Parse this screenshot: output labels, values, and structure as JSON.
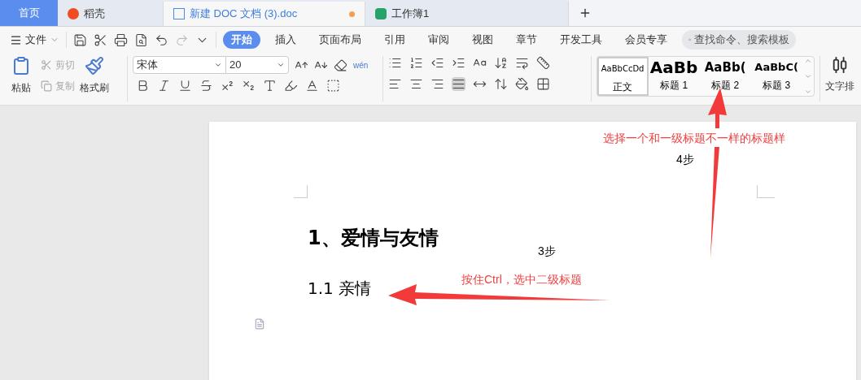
{
  "tabs": [
    {
      "label": "首页",
      "kind": "home",
      "selected": false
    },
    {
      "label": "稻壳",
      "kind": "docer",
      "selected": false
    },
    {
      "label": "新建 DOC 文档 (3).doc",
      "kind": "writer",
      "selected": true,
      "unsaved": true
    },
    {
      "label": "工作簿1",
      "kind": "sheet",
      "selected": false
    }
  ],
  "menu": {
    "file": "文件",
    "items": [
      {
        "label": "开始",
        "selected": true
      },
      {
        "label": "插入",
        "selected": false
      },
      {
        "label": "页面布局",
        "selected": false
      },
      {
        "label": "引用",
        "selected": false
      },
      {
        "label": "审阅",
        "selected": false
      },
      {
        "label": "视图",
        "selected": false
      },
      {
        "label": "章节",
        "selected": false
      },
      {
        "label": "开发工具",
        "selected": false
      },
      {
        "label": "会员专享",
        "selected": false
      }
    ],
    "search_placeholder": "查找命令、搜索模板"
  },
  "clipboard": {
    "paste": "粘贴",
    "cut": "剪切",
    "copy": "复制",
    "format_painter": "格式刷"
  },
  "font": {
    "name": "宋体",
    "size": "20",
    "phonetic": "wén"
  },
  "styles": [
    {
      "preview": "AaBbCcDd",
      "label": "正文",
      "kind": "normal",
      "selected": true
    },
    {
      "preview": "AaBb",
      "label": "标题 1",
      "kind": "h1",
      "selected": false
    },
    {
      "preview": "AaBb(",
      "label": "标题 2",
      "kind": "h2",
      "selected": false
    },
    {
      "preview": "AaBbC(",
      "label": "标题 3",
      "kind": "h3",
      "selected": false
    }
  ],
  "text_tool": "文字排",
  "document": {
    "heading_1": "1、爱情与友情",
    "heading_2": "1.1 亲情"
  },
  "annotations": [
    {
      "text": "选择一个和一级标题不一样的标题样",
      "kind": "note"
    },
    {
      "text": "4步",
      "kind": "step"
    },
    {
      "text": "3步",
      "kind": "step"
    },
    {
      "text": "按住Ctrl，选中二级标题",
      "kind": "note"
    }
  ]
}
